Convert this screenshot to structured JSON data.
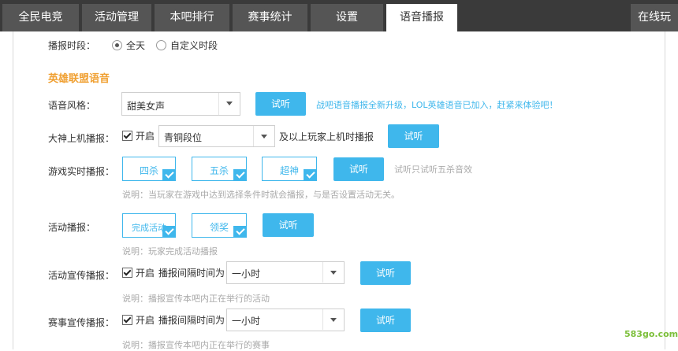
{
  "tabs": [
    {
      "label": "全民电竞"
    },
    {
      "label": "活动管理"
    },
    {
      "label": "本吧排行"
    },
    {
      "label": "赛事统计"
    },
    {
      "label": "设置"
    },
    {
      "label": "语音播报",
      "active": true
    },
    {
      "label": "在线玩"
    }
  ],
  "broadcast_period": {
    "label": "播报时段：",
    "options": [
      {
        "label": "全天",
        "selected": true
      },
      {
        "label": "自定义时段",
        "selected": false
      }
    ]
  },
  "section_title": "英雄联盟语音",
  "voice_style": {
    "label": "语音风格：",
    "value": "甜美女声",
    "listen": "试听",
    "promo": "战吧语音播报全新升级，LOL英雄语音已加入，赶紧来体验吧！"
  },
  "god_online": {
    "label": "大神上机播报：",
    "enabled": true,
    "enable_label": "开启",
    "rank_value": "青铜段位",
    "suffix": "及以上玩家上机时播报",
    "listen": "试听"
  },
  "realtime": {
    "label": "游戏实时播报：",
    "options": [
      {
        "label": "四杀",
        "checked": true
      },
      {
        "label": "五杀",
        "checked": true
      },
      {
        "label": "超神",
        "checked": true
      }
    ],
    "listen": "试听",
    "hint": "试听只试听五杀音效",
    "note": "说明：当玩家在游戏中达到选择条件时就会播报，与是否设置活动无关。"
  },
  "activity": {
    "label": "活动播报：",
    "options": [
      {
        "label": "完成活动",
        "checked": true
      },
      {
        "label": "领奖",
        "checked": true
      }
    ],
    "listen": "试听",
    "note": "说明：玩家完成活动播报"
  },
  "activity_promo": {
    "label": "活动宣传播报：",
    "enabled": true,
    "enable_label": "开启",
    "interval_label": "播报间隔时间为",
    "interval_value": "一小时",
    "listen": "试听",
    "note": "说明：播报宣传本吧内正在举行的活动"
  },
  "match_promo": {
    "label": "赛事宣传播报：",
    "enabled": true,
    "enable_label": "开启",
    "interval_label": "播报间隔时间为",
    "interval_value": "一小时",
    "listen": "试听",
    "note": "说明：播报宣传本吧内正在举行的赛事"
  },
  "watermark": "583go.com",
  "colors": {
    "accent": "#3fb7ec",
    "section": "#f0a032",
    "tabbar": "#3a3a3a"
  }
}
